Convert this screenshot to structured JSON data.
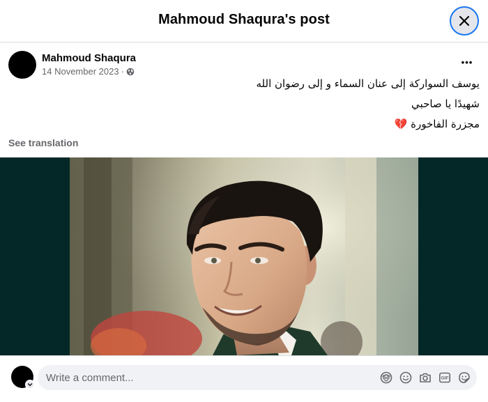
{
  "dialog": {
    "title": "Mahmoud Shaqura's post"
  },
  "post": {
    "author": "Mahmoud Shaqura",
    "date": "14 November 2023",
    "separator": "·",
    "privacy_icon": "globe-icon",
    "more_label": "•••",
    "text_lines": [
      "يوسف السواركة إلى عنان السماء و إلى رضوان الله",
      "شهيدًا يا صاحبي",
      "مجزرة الفاخورة"
    ],
    "emoji": "💔",
    "see_translation": "See translation"
  },
  "comment_bar": {
    "placeholder": "Write a comment...",
    "icons": [
      "avatar-sticker-icon",
      "emoji-icon",
      "camera-icon",
      "gif-icon",
      "sticker-icon"
    ]
  },
  "colors": {
    "accent": "#1877f2",
    "media_bg": "#042727",
    "muted_text": "#65676b"
  }
}
